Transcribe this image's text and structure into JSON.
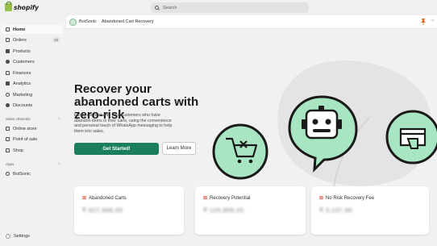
{
  "brand": {
    "name": "shopify"
  },
  "search": {
    "placeholder": "Search"
  },
  "sidebar": {
    "items": [
      {
        "label": "Home",
        "icon": "home-icon",
        "active": true
      },
      {
        "label": "Orders",
        "icon": "orders-icon",
        "badge": "15"
      },
      {
        "label": "Products",
        "icon": "tag-icon"
      },
      {
        "label": "Customers",
        "icon": "person-icon"
      },
      {
        "label": "Finances",
        "icon": "bank-icon"
      },
      {
        "label": "Analytics",
        "icon": "chart-icon"
      },
      {
        "label": "Marketing",
        "icon": "target-icon"
      },
      {
        "label": "Discounts",
        "icon": "discount-icon"
      }
    ],
    "sales_channels_label": "Sales channels",
    "sales_channels": [
      {
        "label": "Online store",
        "icon": "store-icon"
      },
      {
        "label": "Point of sale",
        "icon": "pos-icon"
      },
      {
        "label": "Shop",
        "icon": "shop-bag-icon"
      }
    ],
    "apps_label": "Apps",
    "apps": [
      {
        "label": "BotSonic",
        "icon": "app-icon"
      }
    ],
    "settings_label": "Settings"
  },
  "app_header": {
    "app_name": "BotSonic",
    "page": "Abandoned Cart Recovery"
  },
  "hero": {
    "title": "Recover your abandoned carts with zero-risk",
    "description": "Easily connect with your customers who have abandon items in their carts, using the convenience and personal touch of WhatsApp messaging to help them into sales.",
    "primary_button": "Get Started!",
    "secondary_button": "Learn More"
  },
  "cards": [
    {
      "label": "Abandoned Carts",
      "value": "₹ 627,566.00",
      "icon": "cart-x-icon"
    },
    {
      "label": "Recovery Potential",
      "value": "₹ 125,909.20",
      "icon": "recovery-icon"
    },
    {
      "label": "No Risk Recovery Fee",
      "value": "₹ 3,137.60",
      "icon": "fee-icon"
    }
  ],
  "colors": {
    "accent_green": "#1a7f5a",
    "illustration_mint": "#a8e6c1",
    "page_bg": "#f1f1f1",
    "card_icon": "#d72c0d"
  }
}
